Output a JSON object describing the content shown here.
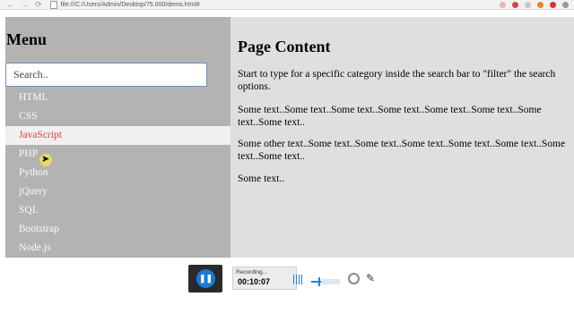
{
  "browser": {
    "url": "file:///C:/Users/Admin/Desktop/75.000/demo.html#"
  },
  "sidebar": {
    "title": "Menu",
    "search_placeholder": "Search..",
    "items": [
      {
        "label": "HTML"
      },
      {
        "label": "CSS"
      },
      {
        "label": "JavaScript"
      },
      {
        "label": "PHP"
      },
      {
        "label": "Python"
      },
      {
        "label": "jQuery"
      },
      {
        "label": "SQL"
      },
      {
        "label": "Bootstrap"
      },
      {
        "label": "Node.js"
      }
    ],
    "hover_index": 2
  },
  "content": {
    "title": "Page Content",
    "paragraphs": [
      "Start to type for a specific category inside the search bar to \"filter\" the search options.",
      "Some text..Some text..Some text..Some text..Some text..Some text..Some text..Some text..",
      "Some other text..Some text..Some text..Some text..Some text..Some text..Some text..Some text..",
      "Some text.."
    ]
  },
  "recorder": {
    "status": "Recording...",
    "time": "00:10:07"
  },
  "colors": {
    "sidebar_bg": "#b3b4b1",
    "content_bg": "#dfdfdd",
    "active_text": "#e23b3b",
    "accent": "#1879d8"
  }
}
